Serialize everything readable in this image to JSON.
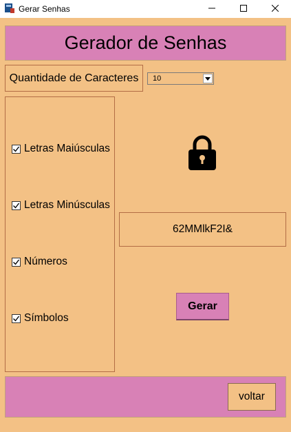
{
  "window": {
    "title": "Gerar Senhas",
    "icons": [
      "app-icon",
      "minimize-icon",
      "maximize-icon",
      "close-icon"
    ]
  },
  "header": {
    "title": "Gerador de Senhas"
  },
  "length": {
    "label": "Quantidade de Caracteres",
    "selected": "10"
  },
  "options": [
    {
      "label": "Letras Maiúsculas",
      "checked": true
    },
    {
      "label": "Letras Minúsculas",
      "checked": true
    },
    {
      "label": "Números",
      "checked": true
    },
    {
      "label": "Símbolos",
      "checked": true
    }
  ],
  "result": {
    "icon": "lock-icon",
    "password": "62MMlkF2I&"
  },
  "actions": {
    "generate_label": "Gerar",
    "back_label": "voltar"
  },
  "colors": {
    "background": "#f3c185",
    "accent": "#d881b6",
    "border": "#b26d45"
  }
}
